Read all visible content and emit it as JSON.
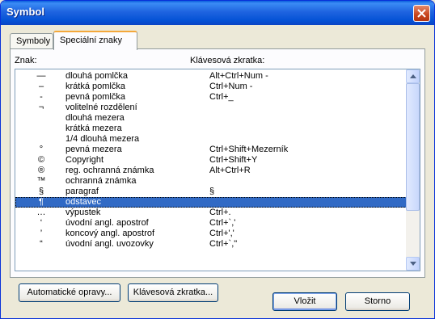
{
  "window": {
    "title": "Symbol"
  },
  "tabs": [
    {
      "label": "Symboly",
      "active": false
    },
    {
      "label": "Speciální znaky",
      "active": true
    }
  ],
  "headers": {
    "znak": "Znak:",
    "shortcut": "Klávesová zkratka:"
  },
  "rows": [
    {
      "sym": "—",
      "name": "dlouhá pomlčka",
      "shortcut": "Alt+Ctrl+Num -"
    },
    {
      "sym": "–",
      "name": "krátká pomlčka",
      "shortcut": "Ctrl+Num -"
    },
    {
      "sym": "-",
      "name": "pevná pomlčka",
      "shortcut": "Ctrl+_"
    },
    {
      "sym": "¬",
      "name": "volitelné rozdělení",
      "shortcut": ""
    },
    {
      "sym": "",
      "name": "dlouhá mezera",
      "shortcut": ""
    },
    {
      "sym": "",
      "name": "krátká mezera",
      "shortcut": ""
    },
    {
      "sym": "",
      "name": "1/4 dlouhá mezera",
      "shortcut": ""
    },
    {
      "sym": "°",
      "name": "pevná mezera",
      "shortcut": "Ctrl+Shift+Mezerník"
    },
    {
      "sym": "©",
      "name": "Copyright",
      "shortcut": "Ctrl+Shift+Y"
    },
    {
      "sym": "®",
      "name": "reg. ochranná známka",
      "shortcut": "Alt+Ctrl+R"
    },
    {
      "sym": "™",
      "name": "ochranná známka",
      "shortcut": ""
    },
    {
      "sym": "§",
      "name": "paragraf",
      "shortcut": "§"
    },
    {
      "sym": "¶",
      "name": "odstavec",
      "shortcut": "",
      "selected": true
    },
    {
      "sym": "…",
      "name": "výpustek",
      "shortcut": "Ctrl+."
    },
    {
      "sym": "‘",
      "name": "úvodní angl. apostrof",
      "shortcut": "Ctrl+`,'"
    },
    {
      "sym": "’",
      "name": "koncový angl. apostrof",
      "shortcut": "Ctrl+','"
    },
    {
      "sym": "“",
      "name": "úvodní angl. uvozovky",
      "shortcut": "Ctrl+`,\""
    }
  ],
  "buttons": {
    "autocorrect": "Automatické opravy...",
    "shortcut": "Klávesová zkratka...",
    "insert": "Vložit",
    "cancel": "Storno"
  },
  "colors": {
    "title_bar": "#0a5fdc",
    "selection": "#316ac5"
  }
}
